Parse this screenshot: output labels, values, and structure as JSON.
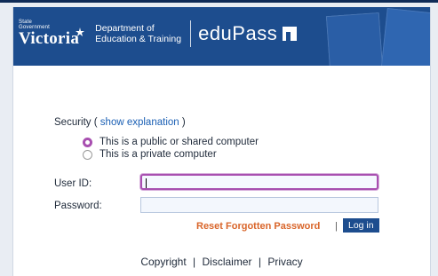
{
  "header": {
    "state_small": "State\nGovernment",
    "state_name": "Victoria",
    "dept_line1": "Department of",
    "dept_line2": "Education & Training",
    "product": "eduPass"
  },
  "security": {
    "label": "Security",
    "open_paren": "(",
    "link": "show explanation",
    "close_paren": ")",
    "options": [
      {
        "label": "This is a public or shared computer",
        "selected": true
      },
      {
        "label": "This is a private computer",
        "selected": false
      }
    ]
  },
  "form": {
    "userid_label": "User ID:",
    "userid_value": "",
    "password_label": "Password:",
    "password_value": "",
    "reset_label": "Reset Forgotten Password",
    "separator": "|",
    "login_label": "Log in"
  },
  "footer": {
    "links": [
      "Copyright",
      "Disclaimer",
      "Privacy"
    ],
    "separator": "|"
  },
  "colors": {
    "brand_blue": "#1d4d8e",
    "accent_purple": "#a84fb0",
    "link_blue": "#1a5fb4",
    "reset_orange": "#d9652a"
  }
}
